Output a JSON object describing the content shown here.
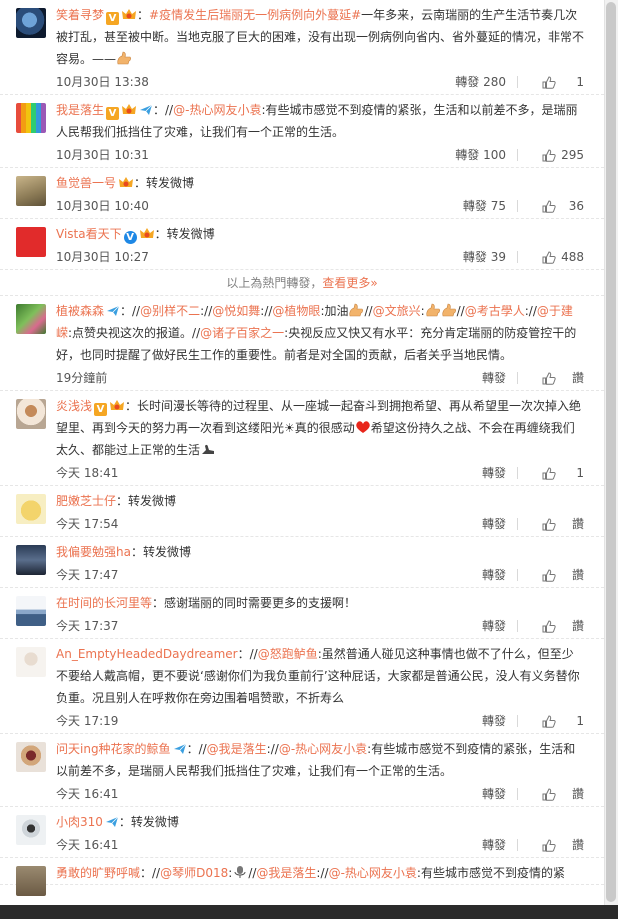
{
  "comments": [
    {
      "user": "笑着寻梦",
      "badges": [
        "vip-yellow-v",
        "lv-badge"
      ],
      "prefix": "：",
      "segments": [
        {
          "type": "topic",
          "text": "#疫情发生后瑞丽无一例病例向外蔓延#"
        },
        {
          "type": "text",
          "text": "一年多来，云南瑞丽的生产生活节奏几次被打乱，甚至被中断。当地克服了巨大的困难，没有出现一例病例向省内、省外蔓延的情况，非常不容易。——"
        }
      ],
      "time": "10月30日 13:38",
      "repost_label": "轉發",
      "repost_count": "280",
      "like_count": "1"
    },
    {
      "user": "我是落生",
      "badges": [
        "vip-yellow-v",
        "lv-badge",
        "plane"
      ],
      "prefix": "：//",
      "segments": [
        {
          "type": "mention",
          "text": "@-热心网友小袁"
        },
        {
          "type": "text",
          "text": ":有些城市感觉不到疫情的紧张，生活和以前差不多，是瑞丽人民帮我们抵挡住了灾难，让我们有一个正常的生活。"
        }
      ],
      "time": "10月30日 10:31",
      "repost_label": "轉發",
      "repost_count": "100",
      "like_count": "295"
    },
    {
      "user": "鱼觉兽一号",
      "badges": [
        "lv-badge"
      ],
      "prefix": "：",
      "segments": [
        {
          "type": "text",
          "text": "转发微博"
        }
      ],
      "time": "10月30日 10:40",
      "repost_label": "轉發",
      "repost_count": "75",
      "like_count": "36"
    },
    {
      "user": "Vista看天下",
      "badges": [
        "vip-blue-v",
        "lv-badge"
      ],
      "prefix": "：",
      "segments": [
        {
          "type": "text",
          "text": "转发微博"
        }
      ],
      "time": "10月30日 10:27",
      "repost_label": "轉發",
      "repost_count": "39",
      "like_count": "488"
    }
  ],
  "hot_note": {
    "text": "以上為熱門轉發，",
    "link": "查看更多»"
  },
  "comments2": [
    {
      "user": "植被森森",
      "badges": [
        "plane"
      ],
      "prefix": "：//",
      "segments": [
        {
          "type": "mention",
          "text": "@别样不二"
        },
        {
          "type": "text",
          "text": "://"
        },
        {
          "type": "mention",
          "text": "@悦如舞"
        },
        {
          "type": "text",
          "text": "://"
        },
        {
          "type": "mention",
          "text": "@植物眼"
        },
        {
          "type": "text",
          "text": ":加油"
        },
        {
          "type": "emoji",
          "text": "strong"
        },
        {
          "type": "text",
          "text": "//"
        },
        {
          "type": "mention",
          "text": "@文旅兴"
        },
        {
          "type": "text",
          "text": ":"
        },
        {
          "type": "emoji",
          "text": "strong"
        },
        {
          "type": "emoji",
          "text": "strong"
        },
        {
          "type": "text",
          "text": "//"
        },
        {
          "type": "mention",
          "text": "@考古學人"
        },
        {
          "type": "text",
          "text": "://"
        },
        {
          "type": "mention",
          "text": "@于建嵘"
        },
        {
          "type": "text",
          "text": ":点赞央视这次的报道。//"
        },
        {
          "type": "mention",
          "text": "@诸子百家之一"
        },
        {
          "type": "text",
          "text": ":央视反应又快又有水平：充分肯定瑞丽的防疫管控干的好，也同时提醒了做好民生工作的重要性。前者是对全国的贡献，后者关乎当地民情。"
        }
      ],
      "time": "19分鐘前",
      "repost_label": "轉發",
      "like_label": "讚"
    },
    {
      "user": "炎浅浅",
      "badges": [
        "vip-yellow-v",
        "lv-badge"
      ],
      "prefix": "：",
      "segments": [
        {
          "type": "text",
          "text": "长时间漫长等待的过程里、从一座城一起奋斗到拥抱希望、再从希望里一次次掉入绝望里、再到今天的努力再一次看到这缕阳光☀真的很感动"
        },
        {
          "type": "emoji",
          "text": "heart"
        },
        {
          "type": "text",
          "text": "希望这份持久之战、不会在再缠绕我们太久、都能过上正常的生活"
        },
        {
          "type": "emoji",
          "text": "arm"
        }
      ],
      "time": "今天 18:41",
      "repost_label": "轉發",
      "like_count": "1"
    },
    {
      "user": "肥嫩芝士仔",
      "badges": [],
      "prefix": "：",
      "segments": [
        {
          "type": "text",
          "text": "转发微博"
        }
      ],
      "time": "今天 17:54",
      "repost_label": "轉發",
      "like_label": "讚"
    },
    {
      "user": "我偏要勉强ha",
      "badges": [],
      "prefix": "：",
      "segments": [
        {
          "type": "text",
          "text": "转发微博"
        }
      ],
      "time": "今天 17:47",
      "repost_label": "轉發",
      "like_label": "讚"
    },
    {
      "user": "在时间的长河里等",
      "badges": [],
      "prefix": "：",
      "segments": [
        {
          "type": "text",
          "text": "感谢瑞丽的同时需要更多的支援啊！"
        }
      ],
      "time": "今天 17:37",
      "repost_label": "轉發",
      "like_label": "讚"
    },
    {
      "user": "An_EmptyHeadedDaydreamer",
      "badges": [],
      "prefix": "：//",
      "segments": [
        {
          "type": "mention",
          "text": "@怒跑鲈鱼"
        },
        {
          "type": "text",
          "text": ":虽然普通人碰见这种事情也做不了什么，但至少不要给人戴高帽，更不要说‘感谢你们为我负重前行’这种屁话，大家都是普通公民，没人有义务替你负重。况且别人在呼救你在旁边围着唱赞歌，不折寿么"
        }
      ],
      "time": "今天 17:19",
      "repost_label": "轉發",
      "like_count": "1"
    },
    {
      "user": "问天ing种花家的鲸鱼",
      "badges": [
        "plane"
      ],
      "prefix": "：//",
      "segments": [
        {
          "type": "mention",
          "text": "@我是落生"
        },
        {
          "type": "text",
          "text": "://"
        },
        {
          "type": "mention",
          "text": "@-热心网友小袁"
        },
        {
          "type": "text",
          "text": ":有些城市感觉不到疫情的紧张，生活和以前差不多，是瑞丽人民帮我们抵挡住了灾难，让我们有一个正常的生活。"
        }
      ],
      "time": "今天 16:41",
      "repost_label": "轉發",
      "like_label": "讚"
    },
    {
      "user": "小肉310",
      "badges": [
        "plane"
      ],
      "prefix": "：",
      "segments": [
        {
          "type": "text",
          "text": "转发微博"
        }
      ],
      "time": "今天 16:41",
      "repost_label": "轉發",
      "like_label": "讚"
    },
    {
      "user": "勇敢的旷野呼喊",
      "badges": [],
      "prefix": "：//",
      "segments": [
        {
          "type": "mention",
          "text": "@琴师D018"
        },
        {
          "type": "text",
          "text": ":"
        },
        {
          "type": "emoji",
          "text": "mic"
        },
        {
          "type": "text",
          "text": "//"
        },
        {
          "type": "mention",
          "text": "@我是落生"
        },
        {
          "type": "text",
          "text": "://"
        },
        {
          "type": "mention",
          "text": "@-热心网友小袁"
        },
        {
          "type": "text",
          "text": ":有些城市感觉不到疫情的紧"
        }
      ],
      "time": "",
      "repost_label": "",
      "like_label": ""
    }
  ],
  "colors": {
    "accent": "#eb7350",
    "text": "#333333",
    "meta": "#555555",
    "background": "#ffffff"
  }
}
